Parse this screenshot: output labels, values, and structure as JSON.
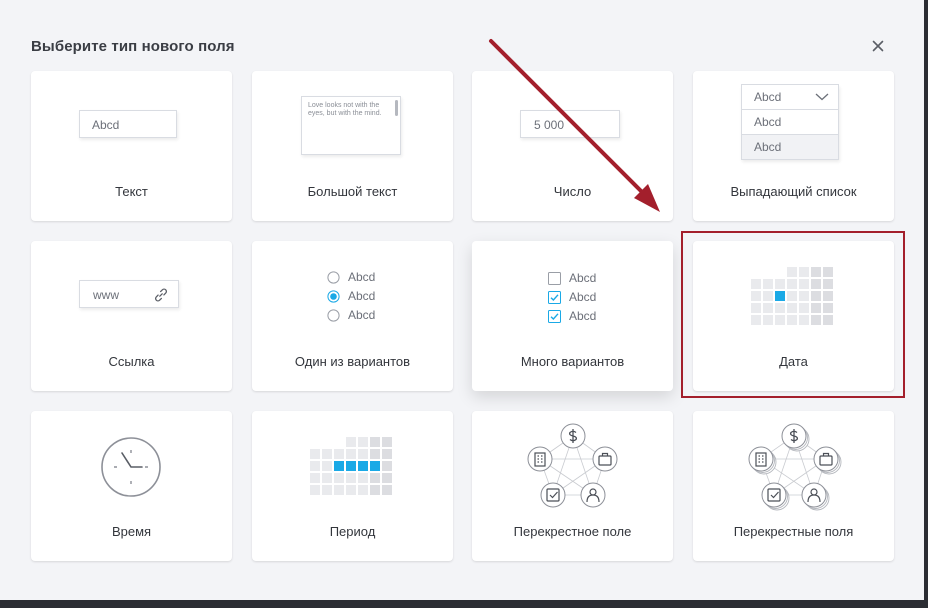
{
  "dialog": {
    "title": "Выберите тип нового поля",
    "close_icon": "close-icon"
  },
  "cards": [
    {
      "id": "text",
      "label": "Текст",
      "preview": "Abcd"
    },
    {
      "id": "big-text",
      "label": "Большой текст",
      "preview": "Love looks not with the eyes, but with the mind."
    },
    {
      "id": "number",
      "label": "Число",
      "preview": "5 000"
    },
    {
      "id": "dropdown",
      "label": "Выпадающий список",
      "options": [
        "Abcd",
        "Abcd",
        "Abcd"
      ],
      "icon": "chevron-down-icon"
    },
    {
      "id": "link",
      "label": "Ссылка",
      "preview": "www",
      "icon": "link-icon"
    },
    {
      "id": "single-choice",
      "label": "Один из вариантов",
      "options": [
        "Abcd",
        "Abcd",
        "Abcd"
      ],
      "selected_index": 1
    },
    {
      "id": "multi-choice",
      "label": "Много вариантов",
      "options": [
        "Abcd",
        "Abcd",
        "Abcd"
      ],
      "checked": [
        false,
        true,
        true
      ]
    },
    {
      "id": "date",
      "label": "Дата",
      "icon": "calendar-icon"
    },
    {
      "id": "time",
      "label": "Время",
      "icon": "clock-icon"
    },
    {
      "id": "period",
      "label": "Период",
      "icon": "calendar-range-icon"
    },
    {
      "id": "cross-field",
      "label": "Перекрестное поле",
      "icon": "entity-network-icon"
    },
    {
      "id": "cross-fields",
      "label": "Перекрестные поля",
      "icon": "entity-network-multiple-icon"
    }
  ],
  "colors": {
    "accent": "#1aa9e6",
    "annotation": "#a31f2c",
    "cell": "#e9eaed",
    "cell_dark": "#dcdde1"
  }
}
